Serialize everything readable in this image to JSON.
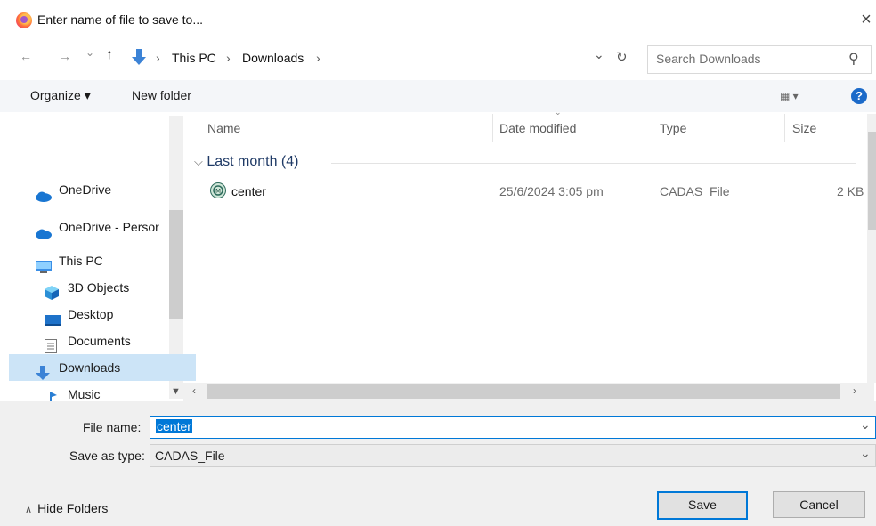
{
  "window": {
    "title": "Enter name of file to save to...",
    "close_glyph": "×"
  },
  "nav": {
    "back": "←",
    "forward": "→",
    "recent": "⌄",
    "up": "↑",
    "path": [
      "This PC",
      "Downloads"
    ],
    "sep": "›",
    "dropdown": "⌄",
    "refresh": "↻",
    "search_placeholder": "Search Downloads",
    "search_glyph": "⚲"
  },
  "toolbar": {
    "organize": "Organize ▾",
    "new_folder": "New folder",
    "view_glyph": "▦ ▾",
    "help": "?"
  },
  "sidebar": {
    "items": [
      {
        "label": "OneDrive",
        "icon": "cloud-icon"
      },
      {
        "label": "OneDrive - Persor",
        "icon": "cloud-icon"
      },
      {
        "label": "This PC",
        "icon": "computer-icon"
      },
      {
        "label": "3D Objects",
        "icon": "cube-icon"
      },
      {
        "label": "Desktop",
        "icon": "desktop-icon"
      },
      {
        "label": "Documents",
        "icon": "document-icon"
      },
      {
        "label": "Downloads",
        "icon": "download-icon",
        "selected": true
      },
      {
        "label": "Music",
        "icon": "music-icon"
      }
    ]
  },
  "list": {
    "columns": [
      "Name",
      "Date modified",
      "Type",
      "Size"
    ],
    "group": "Last month (4)",
    "rows": [
      {
        "name": "center",
        "date": "25/6/2024 3:05 pm",
        "type": "CADAS_File",
        "size": "2 KB"
      }
    ]
  },
  "form": {
    "file_name_label": "File name:",
    "file_name_value": "center",
    "save_type_label": "Save as type:",
    "save_type_value": "CADAS_File",
    "chevron": "⌄"
  },
  "footer": {
    "hide_folders": "Hide Folders",
    "save": "Save",
    "cancel": "Cancel"
  },
  "colors": {
    "accent": "#0078d7",
    "selected_row": "#cce4f7",
    "footer_bg": "#f0f0f0"
  }
}
